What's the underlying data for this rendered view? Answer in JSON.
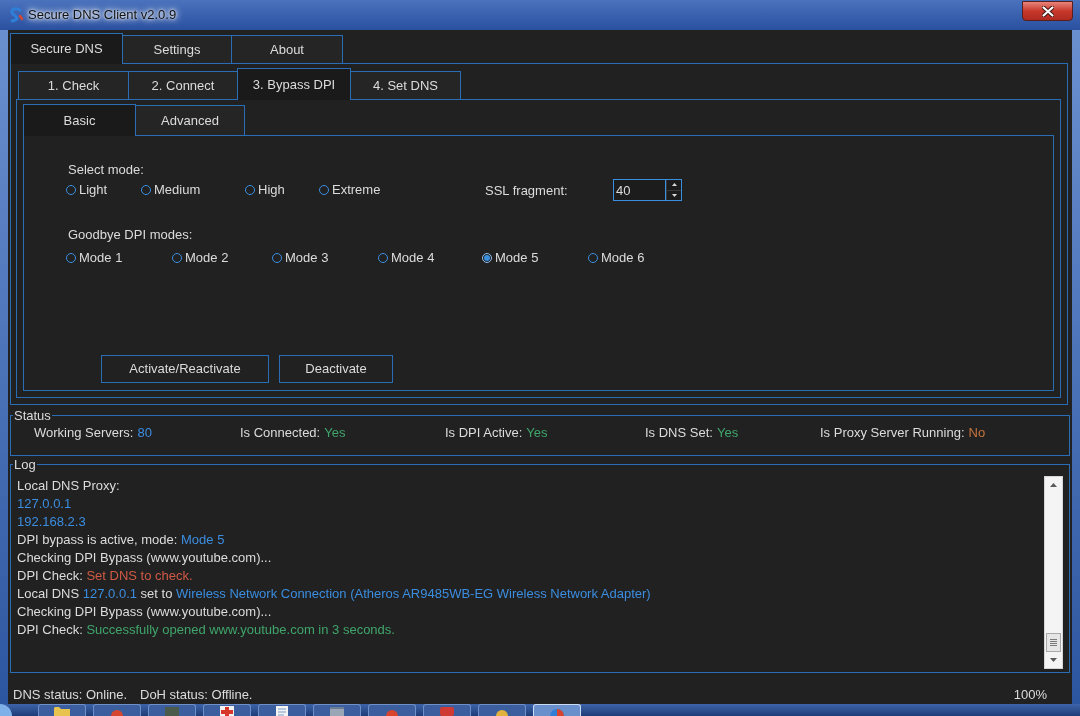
{
  "window": {
    "title": "Secure DNS Client v2.0.9"
  },
  "main_tabs": [
    {
      "label": "Secure DNS",
      "selected": true
    },
    {
      "label": "Settings",
      "selected": false
    },
    {
      "label": "About",
      "selected": false
    }
  ],
  "step_tabs": [
    {
      "label": "1. Check",
      "selected": false
    },
    {
      "label": "2. Connect",
      "selected": false
    },
    {
      "label": "3. Bypass DPI",
      "selected": true
    },
    {
      "label": "4. Set DNS",
      "selected": false
    }
  ],
  "sub_tabs": [
    {
      "label": "Basic",
      "selected": true
    },
    {
      "label": "Advanced",
      "selected": false
    }
  ],
  "select_mode": {
    "label": "Select mode:",
    "options": [
      {
        "label": "Light",
        "selected": false
      },
      {
        "label": "Medium",
        "selected": false
      },
      {
        "label": "High",
        "selected": false
      },
      {
        "label": "Extreme",
        "selected": false
      }
    ]
  },
  "ssl_fragment": {
    "label": "SSL fragment:",
    "value": "40"
  },
  "goodbye_dpi": {
    "label": "Goodbye DPI modes:",
    "options": [
      {
        "label": "Mode 1",
        "selected": false
      },
      {
        "label": "Mode 2",
        "selected": false
      },
      {
        "label": "Mode 3",
        "selected": false
      },
      {
        "label": "Mode 4",
        "selected": false
      },
      {
        "label": "Mode 5",
        "selected": true
      },
      {
        "label": "Mode 6",
        "selected": false
      }
    ]
  },
  "buttons": [
    "Activate/Reactivate",
    "Deactivate"
  ],
  "status": {
    "title": "Status",
    "items": [
      {
        "label": "Working Servers:",
        "value": "80",
        "color": "#3b8de0"
      },
      {
        "label": "Is Connected:",
        "value": "Yes",
        "color": "#3fa56b"
      },
      {
        "label": "Is DPI Active:",
        "value": "Yes",
        "color": "#3fa56b"
      },
      {
        "label": "Is DNS Set:",
        "value": "Yes",
        "color": "#3fa56b"
      },
      {
        "label": "Is Proxy Server Running:",
        "value": "No",
        "color": "#c8743c"
      }
    ]
  },
  "log": {
    "title": "Log",
    "lines": [
      {
        "segments": [
          {
            "text": "Local DNS Proxy:"
          }
        ]
      },
      {
        "segments": [
          {
            "text": "127.0.0.1",
            "color": "#3b8de0"
          }
        ]
      },
      {
        "segments": [
          {
            "text": "192.168.2.3",
            "color": "#3b8de0"
          }
        ]
      },
      {
        "segments": [
          {
            "text": "DPI bypass is active, mode:"
          },
          {
            "text": "Mode 5",
            "color": "#3b8de0"
          }
        ]
      },
      {
        "segments": [
          {
            "text": "Checking DPI Bypass (www.youtube.com)..."
          }
        ]
      },
      {
        "segments": [
          {
            "text": "DPI Check:"
          },
          {
            "text": "Set DNS to check.",
            "color": "#d05a45"
          }
        ]
      },
      {
        "segments": [
          {
            "text": "Local DNS"
          },
          {
            "text": "127.0.0.1",
            "color": "#3b8de0"
          },
          {
            "text": "set to"
          },
          {
            "text": "Wireless Network Connection (Atheros AR9485WB-EG Wireless Network Adapter)",
            "color": "#3b8de0"
          }
        ]
      },
      {
        "segments": [
          {
            "text": "Checking DPI Bypass (www.youtube.com)..."
          }
        ]
      },
      {
        "segments": [
          {
            "text": "DPI Check:"
          },
          {
            "text": "Successfully opened www.youtube.com in 3 seconds.",
            "color": "#3fa56b"
          }
        ]
      }
    ]
  },
  "status_bar": {
    "dns_status": "DNS status: Online.",
    "doh_status": "DoH status: Offline.",
    "zoom": "100%"
  }
}
